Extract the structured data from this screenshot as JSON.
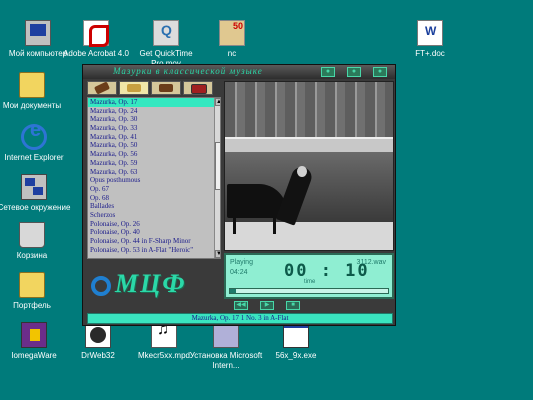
{
  "desktop": {
    "icons": [
      {
        "label": "Мой компьютер",
        "icon": "my-computer-icon"
      },
      {
        "label": "Adobe Acrobat 4.0",
        "icon": "acrobat-icon"
      },
      {
        "label": "Get QuickTime Pro.mov",
        "icon": "quicktime-icon"
      },
      {
        "label": "nc",
        "icon": "nc-icon"
      },
      {
        "label": "FT+.doc",
        "icon": "word-doc-icon"
      },
      {
        "label": "Мои документы",
        "icon": "folder-icon"
      },
      {
        "label": "Internet Explorer",
        "icon": "ie-icon"
      },
      {
        "label": "Сетевое окружение",
        "icon": "network-icon"
      },
      {
        "label": "Корзина",
        "icon": "recycle-bin-icon"
      },
      {
        "label": "Портфель",
        "icon": "briefcase-icon"
      },
      {
        "label": "IomegaWare",
        "icon": "iomega-icon"
      },
      {
        "label": "DrWeb32",
        "icon": "drweb-icon"
      },
      {
        "label": "Mkecr5xx.mpd",
        "icon": "mpd-file-icon"
      },
      {
        "label": "Установка Microsoft Intern...",
        "icon": "setup-icon"
      },
      {
        "label": "56x_9x.exe",
        "icon": "exe-icon"
      }
    ],
    "truncated_labels": [
      "Ad",
      "Ad",
      "Ad",
      "C"
    ]
  },
  "player": {
    "title": "Мазурки в классической музыке",
    "tracks": [
      "Mazurka, Op. 17",
      "Mazurka, Op. 24",
      "Mazurka, Op. 30",
      "Mazurka, Op. 33",
      "Mazurka, Op. 41",
      "Mazurka, Op. 50",
      "Mazurka, Op. 56",
      "Mazurka, Op. 59",
      "Mazurka, Op. 63",
      "Opus posthumous",
      "Op. 67",
      "Op. 68",
      "Ballades",
      "Scherzos",
      "Polonaise, Op. 26",
      "Polonaise, Op. 40",
      "Polonaise, Op. 44 in F-Sharp Minor",
      "Polonaise, Op. 53 in A-Flat \"Heroic\""
    ],
    "selected_index": 0,
    "logo": "МЦФ",
    "display": {
      "status": "Playing",
      "elapsed": "04:24",
      "time": "00 : 10",
      "time_label": "time",
      "file": "3112.wav",
      "progress": 0.04
    },
    "now_playing": "Mazurka, Op. 17 1 No. 3 in A-Flat",
    "colors": {
      "accent": "#3ae4c0",
      "list_text": "#1a1a8a",
      "desktop": "#007b7b"
    }
  }
}
